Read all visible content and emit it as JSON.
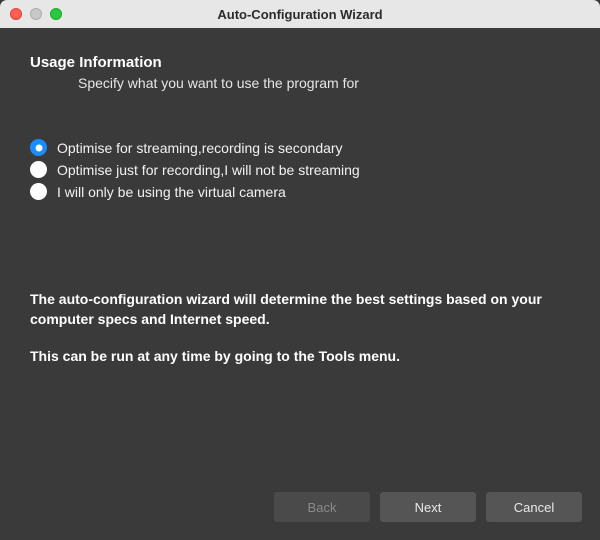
{
  "window": {
    "title": "Auto-Configuration Wizard"
  },
  "header": {
    "title": "Usage Information",
    "subtitle": "Specify what you want to use the program for"
  },
  "options": [
    {
      "label": "Optimise for streaming,recording is secondary",
      "selected": true
    },
    {
      "label": "Optimise just for recording,I will not be streaming",
      "selected": false
    },
    {
      "label": "I will only be using the virtual camera",
      "selected": false
    }
  ],
  "info": {
    "p1": "The auto-configuration wizard will determine the best settings based on your computer specs and Internet speed.",
    "p2": "This can be run at any time by going to the Tools menu."
  },
  "buttons": {
    "back": "Back",
    "next": "Next",
    "cancel": "Cancel"
  }
}
